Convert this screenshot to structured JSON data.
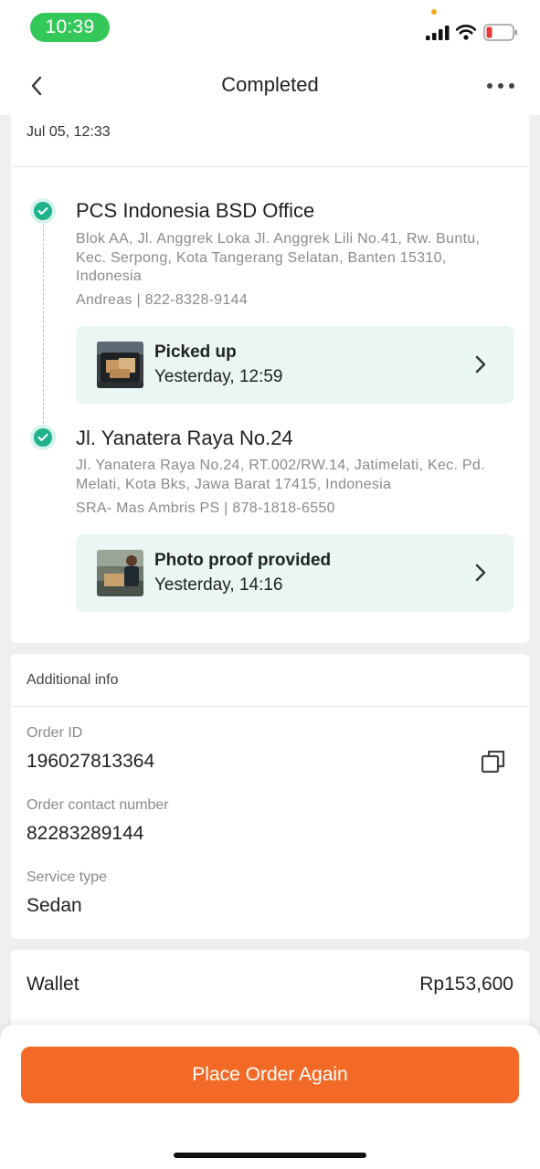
{
  "status_bar": {
    "time": "10:39",
    "icons": [
      "signal-icon",
      "wifi-icon",
      "battery-low-icon"
    ]
  },
  "nav": {
    "title": "Completed",
    "back_icon": "chevron-left-icon",
    "more_icon": "more-horizontal-icon"
  },
  "route": {
    "date": "Jul 05, 12:33",
    "stops": [
      {
        "title": "PCS Indonesia BSD Office",
        "address": "Blok AA, Jl. Anggrek Loka Jl. Anggrek Lili No.41, Rw. Buntu, Kec. Serpong, Kota Tangerang Selatan, Banten 15310, Indonesia",
        "contact": "Andreas  |  822-8328-9144",
        "event": {
          "title": "Picked up",
          "time": "Yesterday, 12:59"
        }
      },
      {
        "title": "Jl. Yanatera Raya No.24",
        "address": "Jl. Yanatera Raya No.24, RT.002/RW.14, Jatimelati, Kec. Pd. Melati, Kota Bks, Jawa Barat 17415, Indonesia",
        "contact": "SRA- Mas Ambris PS  |  878-1818-6550",
        "event": {
          "title": "Photo proof provided",
          "time": "Yesterday, 14:16"
        }
      }
    ]
  },
  "additional_info": {
    "header": "Additional info",
    "fields": [
      {
        "label": "Order ID",
        "value": "196027813364"
      },
      {
        "label": "Order contact number",
        "value": "82283289144"
      },
      {
        "label": "Service type",
        "value": "Sedan"
      }
    ]
  },
  "payment": {
    "label": "Wallet",
    "amount": "Rp153,600"
  },
  "cta": {
    "label": "Place Order Again"
  },
  "colors": {
    "accent": "#f26a25",
    "success": "#1fb38b",
    "event_bg": "#e9f6f3",
    "time_pill": "#34c759"
  }
}
